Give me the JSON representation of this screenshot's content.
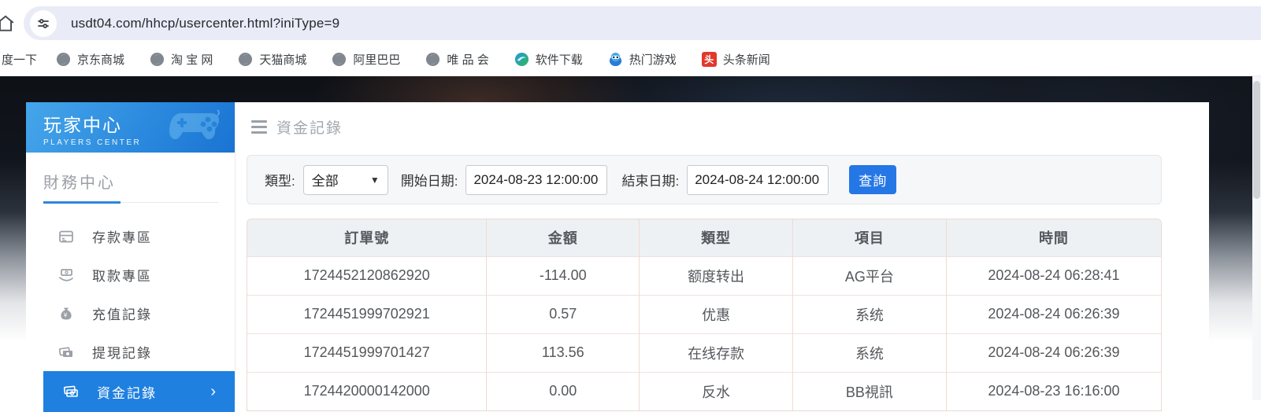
{
  "browser": {
    "url": "usdt04.com/hhcp/usercenter.html?iniType=9",
    "bookmarks": [
      {
        "label": "度一下",
        "icon": "none"
      },
      {
        "label": "京东商城",
        "icon": "globe"
      },
      {
        "label": "淘 宝 网",
        "icon": "globe"
      },
      {
        "label": "天猫商城",
        "icon": "globe"
      },
      {
        "label": "阿里巴巴",
        "icon": "globe"
      },
      {
        "label": "唯 品 会",
        "icon": "globe"
      },
      {
        "label": "软件下载",
        "icon": "software"
      },
      {
        "label": "热门游戏",
        "icon": "game"
      },
      {
        "label": "头条新闻",
        "icon": "toutiao",
        "badge": "头"
      }
    ]
  },
  "sidebar": {
    "title": "玩家中心",
    "subtitle": "PLAYERS CENTER",
    "section_title": "財務中心",
    "items": [
      {
        "label": "存款專區"
      },
      {
        "label": "取款專區"
      },
      {
        "label": "充值記錄"
      },
      {
        "label": "提現記錄"
      },
      {
        "label": "資金記錄",
        "chevron": "›"
      }
    ]
  },
  "main": {
    "page_title": "資金記錄",
    "filter": {
      "type_label": "類型:",
      "type_value": "全部",
      "start_label": "開始日期:",
      "start_value": "2024-08-23 12:00:00",
      "end_label": "結束日期:",
      "end_value": "2024-08-24 12:00:00",
      "search_label": "查詢"
    },
    "table": {
      "headers": [
        "訂單號",
        "金額",
        "類型",
        "項目",
        "時間"
      ],
      "rows": [
        [
          "1724452120862920",
          "-114.00",
          "额度转出",
          "AG平台",
          "2024-08-24 06:28:41"
        ],
        [
          "1724451999702921",
          "0.57",
          "优惠",
          "系统",
          "2024-08-24 06:26:39"
        ],
        [
          "1724451999701427",
          "113.56",
          "在线存款",
          "系统",
          "2024-08-24 06:26:39"
        ],
        [
          "1724420000142000",
          "0.00",
          "反水",
          "BB視訊",
          "2024-08-23 16:16:00"
        ]
      ]
    }
  },
  "colors": {
    "accent_button": "#2577e6",
    "sidebar_active": "#1f80e0",
    "banner_start": "#46a6ea",
    "banner_end": "#1a73d2",
    "toutiao_red": "#e2382b"
  }
}
